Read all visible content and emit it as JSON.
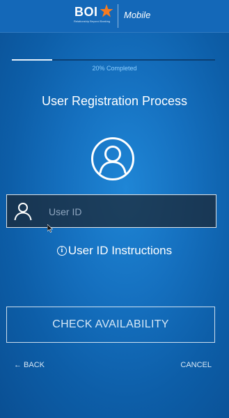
{
  "header": {
    "logo_text": "BOI",
    "logo_tagline": "Relationship Beyond Banking",
    "app_name": "Mobile"
  },
  "progress": {
    "value": 0.2,
    "label": "20% Completed"
  },
  "title": "User Registration Process",
  "user_id_field": {
    "value": "",
    "placeholder": "User ID"
  },
  "instructions_label": "User ID Instructions",
  "check_button_label": "CHECK AVAILABILITY",
  "footer": {
    "back_label": "← BACK",
    "cancel_label": "CANCEL"
  },
  "icons": {
    "logo": "star-logo-icon",
    "avatar": "user-avatar-icon",
    "input": "user-icon",
    "info": "info-icon"
  },
  "colors": {
    "background": "#1570bf",
    "header": "#1468b8",
    "progress_text": "#8fd0ff",
    "star_orange": "#f47b20"
  }
}
